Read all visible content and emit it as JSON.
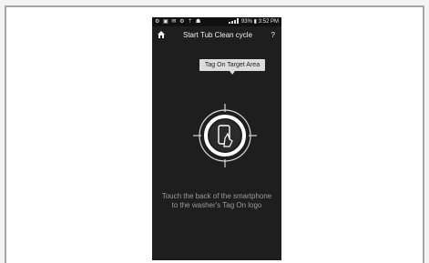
{
  "status_bar": {
    "battery": "93%",
    "time": "3:52 PM"
  },
  "header": {
    "title": "Start Tub Clean cycle",
    "help": "?"
  },
  "tooltip": {
    "label": "Tag On Target Area"
  },
  "instruction": {
    "text": "Touch the back of the smartphone to the washer's Tag On logo"
  },
  "colors": {
    "screen_background": "#1e1e1e",
    "tooltip_background": "#dcdcdc"
  }
}
